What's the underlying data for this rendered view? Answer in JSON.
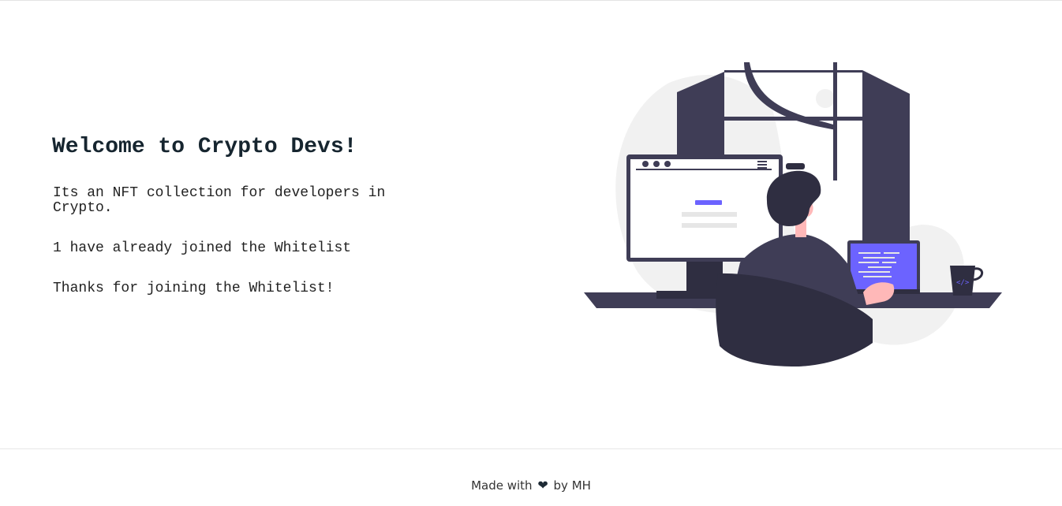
{
  "main": {
    "title": "Welcome to Crypto Devs!",
    "description": "Its an NFT collection for developers in Crypto.",
    "joined_text": "1 have already joined the Whitelist",
    "status_text": "Thanks for joining the Whitelist!"
  },
  "illustration": {
    "icon": "developer-at-desk-illustration",
    "accent_color": "#6c63ff",
    "dark_color": "#3f3d56"
  },
  "footer": {
    "made_with": "Made with",
    "heart_icon": "heart-icon",
    "by": "by MH"
  }
}
